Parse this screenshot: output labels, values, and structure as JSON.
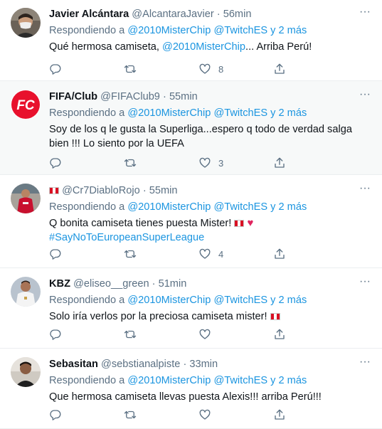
{
  "tweets": [
    {
      "name": "Javier Alcántara",
      "handle": "@AlcantaraJavier",
      "dot": "·",
      "time": "56min",
      "reply_prefix": "Respondiendo a",
      "reply_to_1": "@2010MisterChip",
      "reply_to_2": "@TwitchES",
      "reply_suffix": "y 2 más",
      "text_1": "Qué hermosa camiseta,",
      "mention": "@2010MisterChip",
      "text_2": "... Arriba Perú!",
      "likes": "8",
      "avatar_icon": "person-mask-avatar"
    },
    {
      "name": "FIFA/Club",
      "handle": "@FIFAClub9",
      "dot": "·",
      "time": "55min",
      "reply_prefix": "Respondiendo a",
      "reply_to_1": "@2010MisterChip",
      "reply_to_2": "@TwitchES",
      "reply_suffix": "y 2 más",
      "text": "Soy de los q le gusta la Superliga...espero q todo de verdad salga bien !!! Lo siento por la UEFA",
      "likes": "3",
      "avatar_letters": "FC"
    },
    {
      "handle": "@Cr7DiabloRojo",
      "dot": "·",
      "time": "55min",
      "reply_prefix": "Respondiendo a",
      "reply_to_1": "@2010MisterChip",
      "reply_to_2": "@TwitchES",
      "reply_suffix": "y 2 más",
      "text": "Q bonita camiseta tienes puesta Mister!",
      "hashtag": "#SayNoToEuropeanSuperLeague",
      "likes": "4",
      "avatar_icon": "player-red-avatar"
    },
    {
      "name": "KBZ",
      "handle": "@eliseo__green",
      "dot": "·",
      "time": "51min",
      "reply_prefix": "Respondiendo a",
      "reply_to_1": "@2010MisterChip",
      "reply_to_2": "@TwitchES",
      "reply_suffix": "y 2 más",
      "text": "Solo iría verlos por la preciosa camiseta mister!",
      "avatar_icon": "player-white-avatar"
    },
    {
      "name": "Sebasitan",
      "handle": "@sebstianalpiste",
      "dot": "·",
      "time": "33min",
      "reply_prefix": "Respondiendo a",
      "reply_to_1": "@2010MisterChip",
      "reply_to_2": "@TwitchES",
      "reply_suffix": "y 2 más",
      "text": "Que hermosa camiseta llevas puesta Alexis!!! arriba Perú!!!",
      "avatar_icon": "person-avatar"
    }
  ],
  "icons": {
    "reply": "reply-icon",
    "retweet": "retweet-icon",
    "like": "heart-icon",
    "share": "share-icon",
    "more": "more-icon",
    "flag": "peru-flag-icon"
  },
  "colors": {
    "link": "#1b95e0",
    "muted": "#5b7083",
    "text": "#0f1419",
    "highlight_bg": "#f7f9f9",
    "heart_emoji": "#e0245e"
  },
  "more_glyph": "···"
}
